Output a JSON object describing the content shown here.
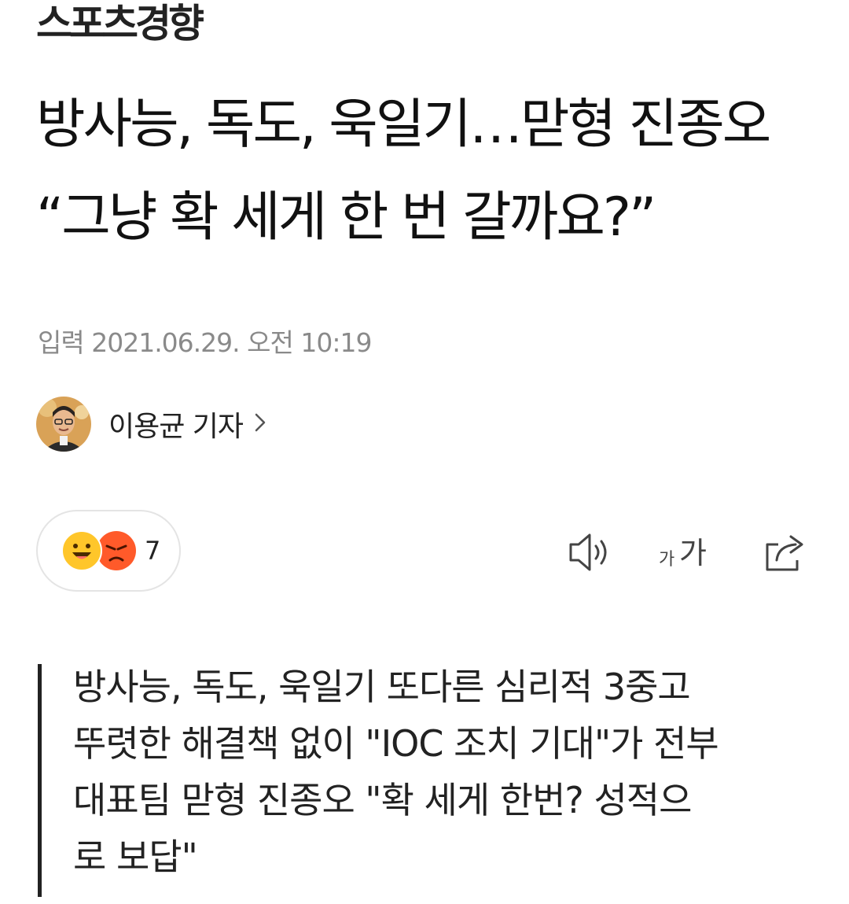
{
  "brand": {
    "logo_text": "스포츠경향"
  },
  "article": {
    "headline": "방사능, 독도, 욱일기…맏형 진종오 “그냥 확 세게 한 번 갈까요?”",
    "published": "입력 2021.06.29. 오전 10:19",
    "author": "이용균 기자"
  },
  "reactions": {
    "count": "7",
    "emojis": [
      "smile-emoji",
      "angry-emoji"
    ]
  },
  "toolbar": {
    "icons": [
      "audio-icon",
      "font-size-icon",
      "share-icon"
    ]
  },
  "summary": {
    "lines": [
      "방사능, 독도, 욱일기 또다른 심리적 3중고",
      "뚜렷한 해결책 없이 \"IOC 조치 기대\"가 전부",
      "대표팀 맏형 진종오 \"확 세게 한번? 성적으",
      "로 보답\""
    ]
  }
}
